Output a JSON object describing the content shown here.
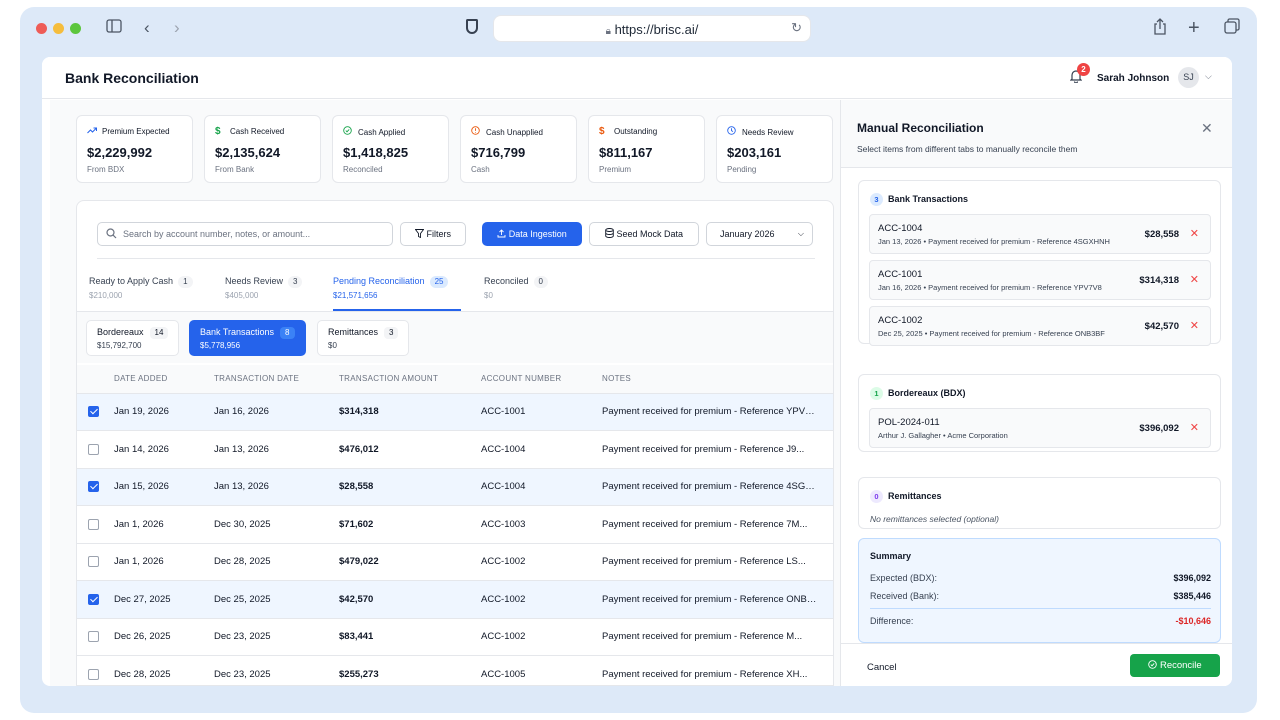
{
  "browser": {
    "url": "https://brisc.ai/"
  },
  "header": {
    "title": "Bank Reconciliation",
    "notification_count": "2",
    "user_name": "Sarah Johnson",
    "user_initials": "SJ"
  },
  "cards": [
    {
      "label": "Premium Expected",
      "value": "$2,229,992",
      "sub": "From BDX",
      "icon": "trend-up-icon",
      "color": "#2563eb"
    },
    {
      "label": "Cash Received",
      "value": "$2,135,624",
      "sub": "From Bank",
      "icon": "dollar-icon",
      "color": "#16a34a"
    },
    {
      "label": "Cash Applied",
      "value": "$1,418,825",
      "sub": "Reconciled",
      "icon": "check-circle-icon",
      "color": "#16a34a"
    },
    {
      "label": "Cash Unapplied",
      "value": "$716,799",
      "sub": "Cash",
      "icon": "alert-circle-icon",
      "color": "#ea580c"
    },
    {
      "label": "Outstanding",
      "value": "$811,167",
      "sub": "Premium",
      "icon": "dollar-icon",
      "color": "#ea580c"
    },
    {
      "label": "Needs Review",
      "value": "$203,161",
      "sub": "Pending",
      "icon": "clock-icon",
      "color": "#2563eb"
    }
  ],
  "toolbar": {
    "search_placeholder": "Search by account number, notes, or amount...",
    "filters_label": "Filters",
    "ingest_label": "Data Ingestion",
    "seed_label": "Seed Mock Data",
    "month_value": "January 2026"
  },
  "tabs": [
    {
      "label": "Ready to Apply Cash",
      "count": "1",
      "sub": "$210,000"
    },
    {
      "label": "Needs Review",
      "count": "3",
      "sub": "$405,000"
    },
    {
      "label": "Pending Reconciliation",
      "count": "25",
      "sub": "$21,571,656"
    },
    {
      "label": "Reconciled",
      "count": "0",
      "sub": "$0"
    }
  ],
  "subtabs": [
    {
      "label": "Bordereaux",
      "count": "14",
      "sub": "$15,792,700"
    },
    {
      "label": "Bank Transactions",
      "count": "8",
      "sub": "$5,778,956"
    },
    {
      "label": "Remittances",
      "count": "3",
      "sub": "$0"
    }
  ],
  "table": {
    "headers": [
      "DATE ADDED",
      "TRANSACTION DATE",
      "TRANSACTION AMOUNT",
      "ACCOUNT NUMBER",
      "NOTES"
    ],
    "rows": [
      {
        "checked": true,
        "date_added": "Jan 19, 2026",
        "txn_date": "Jan 16, 2026",
        "amount": "$314,318",
        "account": "ACC-1001",
        "notes": "Payment received for premium - Reference YPV7V8"
      },
      {
        "checked": false,
        "date_added": "Jan 14, 2026",
        "txn_date": "Jan 13, 2026",
        "amount": "$476,012",
        "account": "ACC-1004",
        "notes": "Payment received for premium - Reference J9..."
      },
      {
        "checked": true,
        "date_added": "Jan 15, 2026",
        "txn_date": "Jan 13, 2026",
        "amount": "$28,558",
        "account": "ACC-1004",
        "notes": "Payment received for premium - Reference 4SGXHNH"
      },
      {
        "checked": false,
        "date_added": "Jan 1, 2026",
        "txn_date": "Dec 30, 2025",
        "amount": "$71,602",
        "account": "ACC-1003",
        "notes": "Payment received for premium - Reference 7M..."
      },
      {
        "checked": false,
        "date_added": "Jan 1, 2026",
        "txn_date": "Dec 28, 2025",
        "amount": "$479,022",
        "account": "ACC-1002",
        "notes": "Payment received for premium - Reference LS..."
      },
      {
        "checked": true,
        "date_added": "Dec 27, 2025",
        "txn_date": "Dec 25, 2025",
        "amount": "$42,570",
        "account": "ACC-1002",
        "notes": "Payment received for premium - Reference ONB3BF"
      },
      {
        "checked": false,
        "date_added": "Dec 26, 2025",
        "txn_date": "Dec 23, 2025",
        "amount": "$83,441",
        "account": "ACC-1002",
        "notes": "Payment received for premium - Reference M..."
      },
      {
        "checked": false,
        "date_added": "Dec 28, 2025",
        "txn_date": "Dec 23, 2025",
        "amount": "$255,273",
        "account": "ACC-1005",
        "notes": "Payment received for premium - Reference XH..."
      }
    ]
  },
  "side": {
    "title": "Manual Reconciliation",
    "subtitle": "Select items from different tabs to manually reconcile them",
    "bank": {
      "count": "3",
      "title": "Bank Transactions",
      "items": [
        {
          "account": "ACC-1004",
          "detail": "Jan 13, 2026 • Payment received for premium - Reference 4SGXHNH",
          "amount": "$28,558"
        },
        {
          "account": "ACC-1001",
          "detail": "Jan 16, 2026 • Payment received for premium - Reference YPV7V8",
          "amount": "$314,318"
        },
        {
          "account": "ACC-1002",
          "detail": "Dec 25, 2025 • Payment received for premium - Reference ONB3BF",
          "amount": "$42,570"
        }
      ]
    },
    "bdx": {
      "count": "1",
      "title": "Bordereaux (BDX)",
      "items": [
        {
          "account": "POL-2024-011",
          "detail": "Arthur J. Gallagher • Acme Corporation",
          "amount": "$396,092"
        }
      ]
    },
    "remit": {
      "count": "0",
      "title": "Remittances",
      "empty": "No remittances selected (optional)"
    },
    "summary": {
      "title": "Summary",
      "expected_label": "Expected (BDX):",
      "expected_value": "$396,092",
      "received_label": "Received (Bank):",
      "received_value": "$385,446",
      "diff_label": "Difference:",
      "diff_value": "-$10,646",
      "diff_color": "#dc2626"
    },
    "cancel_label": "Cancel",
    "reconcile_label": "Reconcile"
  }
}
